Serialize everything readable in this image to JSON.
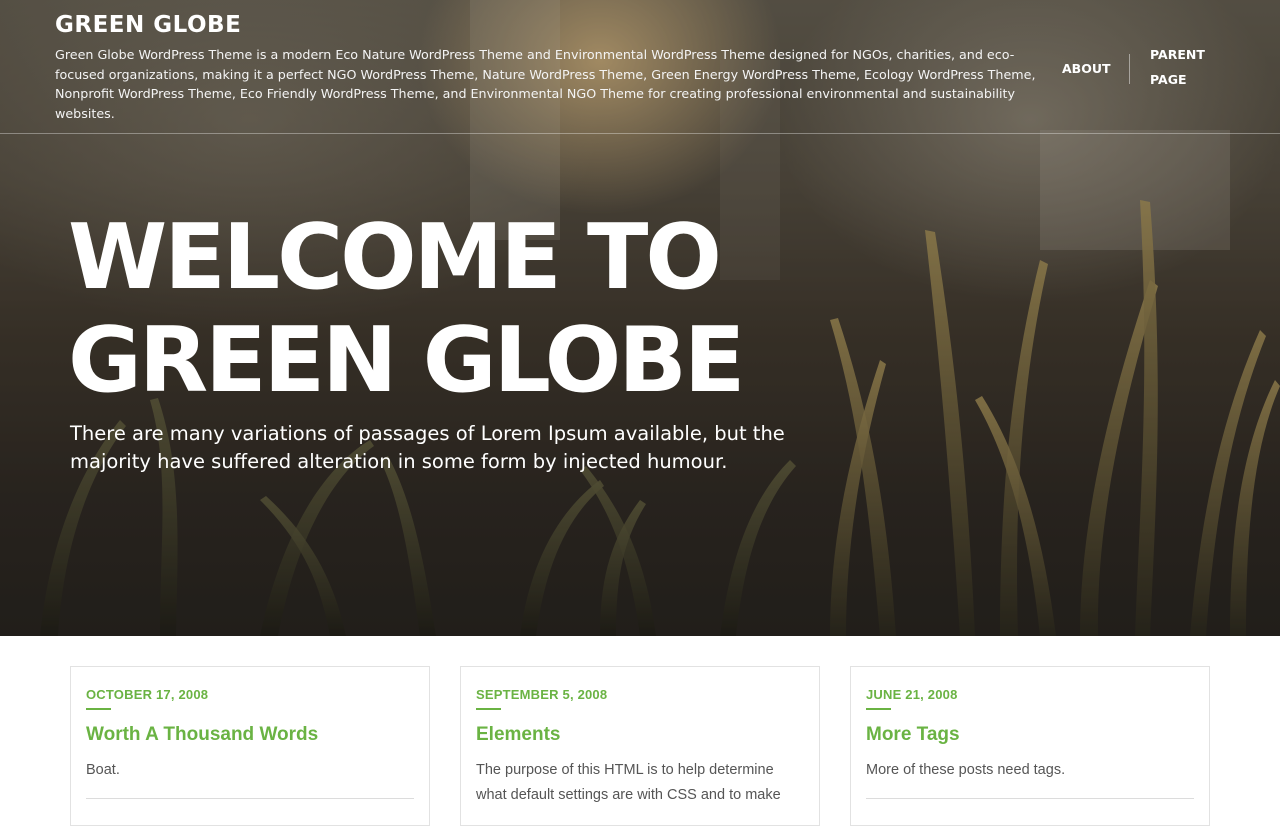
{
  "site": {
    "title": "GREEN GLOBE",
    "description": "Green Globe WordPress Theme is a modern Eco Nature WordPress Theme and Environmental WordPress Theme designed for NGOs, charities, and eco-focused organizations, making it a perfect NGO WordPress Theme, Nature WordPress Theme, Green Energy WordPress Theme, Ecology WordPress Theme, Nonprofit WordPress Theme, Eco Friendly WordPress Theme, and Environmental NGO Theme for creating professional environmental and sustainability websites."
  },
  "nav": {
    "items": [
      {
        "label": "ABOUT"
      },
      {
        "label": "PARENT PAGE"
      }
    ]
  },
  "hero": {
    "title_line1": "WELCOME TO",
    "title_line2": "GREEN GLOBE",
    "subtitle": "There are many variations of passages of Lorem Ipsum available, but the majority have suffered alteration in some form by injected humour."
  },
  "posts": [
    {
      "date": "OCTOBER 17, 2008",
      "title": "Worth A Thousand Words",
      "excerpt": "Boat."
    },
    {
      "date": "SEPTEMBER 5, 2008",
      "title": "Elements",
      "excerpt": "The purpose of this HTML is to help determine what default settings are with CSS and to make"
    },
    {
      "date": "JUNE 21, 2008",
      "title": "More Tags",
      "excerpt": "More of these posts need tags."
    }
  ],
  "colors": {
    "accent": "#6ab343",
    "hero_text": "#ffffff"
  }
}
